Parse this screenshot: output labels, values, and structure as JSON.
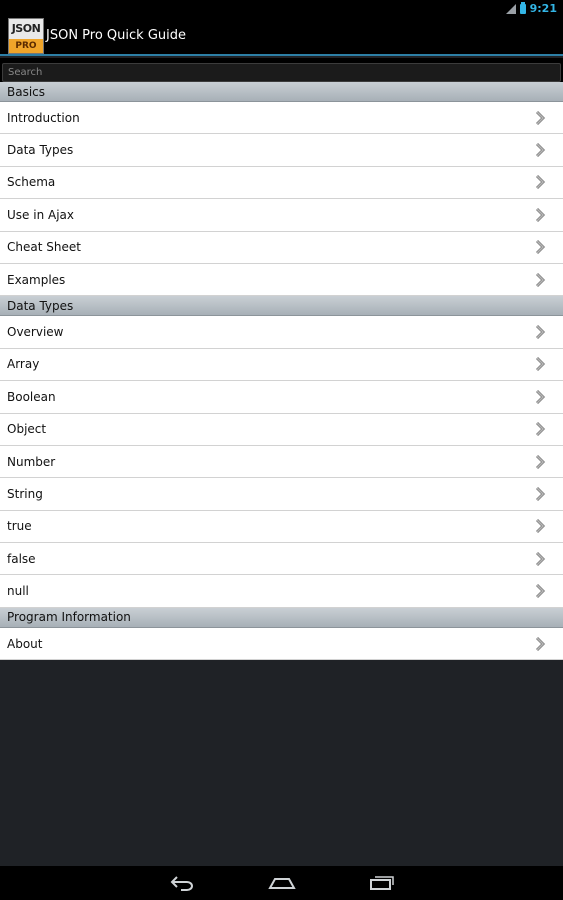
{
  "status_bar": {
    "time": "9:21",
    "icons": [
      "signal-icon",
      "battery-icon"
    ]
  },
  "app": {
    "title": "JSON Pro Quick Guide",
    "logo_top": "JSON",
    "logo_bottom": "PRO"
  },
  "search": {
    "placeholder": "Search",
    "value": ""
  },
  "sections": [
    {
      "header": "Basics",
      "items": [
        "Introduction",
        "Data Types",
        "Schema",
        "Use in Ajax",
        "Cheat Sheet",
        "Examples"
      ]
    },
    {
      "header": "Data Types",
      "items": [
        "Overview",
        "Array",
        "Boolean",
        "Object",
        "Number",
        "String",
        "true",
        "false",
        "null"
      ]
    },
    {
      "header": "Program Information",
      "items": [
        "About"
      ]
    }
  ],
  "nav_bar": {
    "icons": [
      "back-icon",
      "home-icon",
      "recent-apps-icon"
    ]
  },
  "colors": {
    "accent": "#33b5e5",
    "action_bar_underline": "#2d7fa6",
    "logo_orange": "#f0a52a",
    "background": "#1f2226"
  }
}
